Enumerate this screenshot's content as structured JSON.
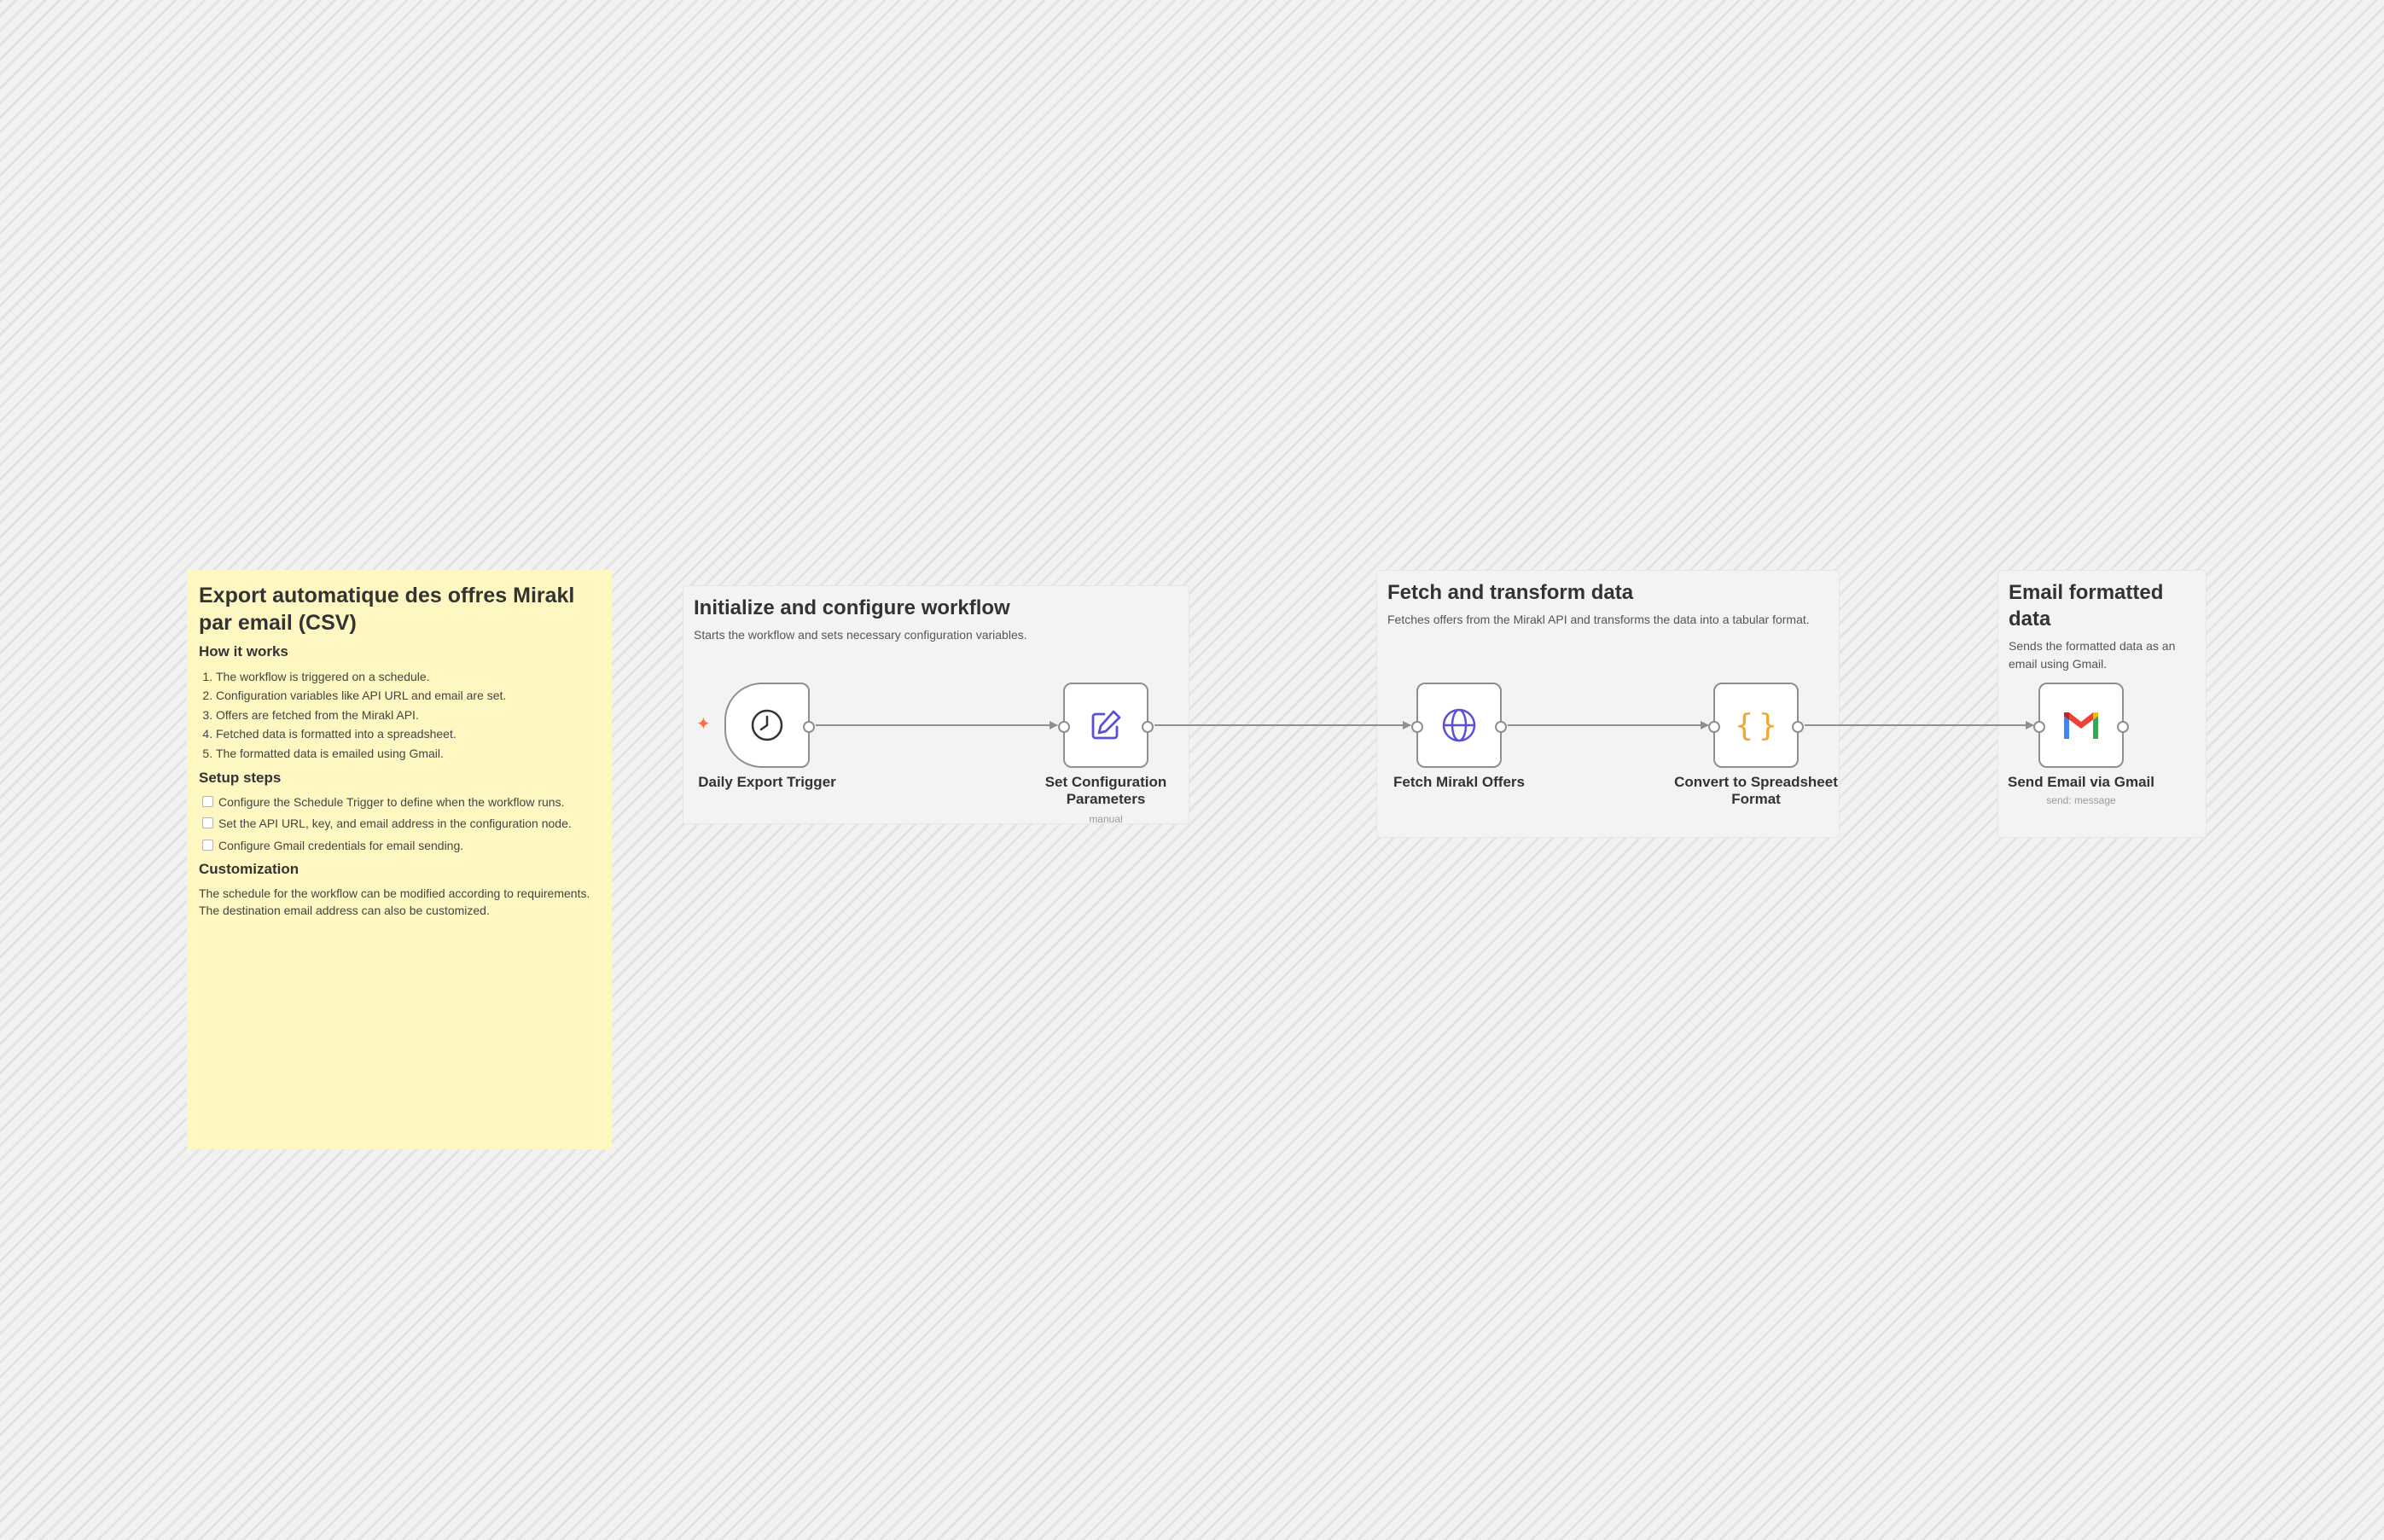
{
  "notes": {
    "main": {
      "title": "Export automatique des offres Mirakl par email (CSV)",
      "how_heading": "How it works",
      "how_steps": [
        "The workflow is triggered on a schedule.",
        "Configuration variables like API URL and email are set.",
        "Offers are fetched from the Mirakl API.",
        "Fetched data is formatted into a spreadsheet.",
        "The formatted data is emailed using Gmail."
      ],
      "setup_heading": "Setup steps",
      "setup_steps": [
        "Configure the Schedule Trigger to define when the workflow runs.",
        "Set the API URL, key, and email address in the configuration node.",
        "Configure Gmail credentials for email sending."
      ],
      "custom_heading": "Customization",
      "custom_text": "The schedule for the workflow can be modified according to requirements. The destination email address can also be customized."
    },
    "group1": {
      "title": "Initialize and configure workflow",
      "desc": "Starts the workflow and sets necessary configuration variables."
    },
    "group2": {
      "title": "Fetch and transform data",
      "desc": "Fetches offers from the Mirakl API and transforms the data into a tabular format."
    },
    "group3": {
      "title": "Email formatted data",
      "desc": "Sends the formatted data as an email using Gmail."
    }
  },
  "nodes": {
    "trigger": {
      "label": "Daily Export Trigger",
      "icon": "clock-icon"
    },
    "config": {
      "label": "Set Configuration Parameters",
      "sub": "manual",
      "icon": "edit-icon"
    },
    "fetch": {
      "label": "Fetch Mirakl Offers",
      "icon": "globe-icon"
    },
    "convert": {
      "label": "Convert to Spreadsheet Format",
      "icon": "braces-icon"
    },
    "gmail": {
      "label": "Send Email via Gmail",
      "sub": "send: message",
      "icon": "gmail-icon"
    }
  },
  "colors": {
    "sticky_yellow": "#fff7c2",
    "icon_purple": "#5a50d8",
    "icon_orange": "#f0a830",
    "trigger_bolt": "#ff6d3a",
    "edge": "#8f8f8f"
  }
}
